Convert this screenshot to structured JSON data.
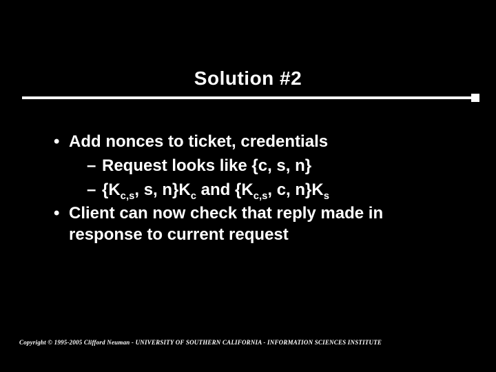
{
  "title": "Solution #2",
  "bullets": {
    "b1": "Add nonces to ticket, credentials",
    "b1a": "Request looks like {c, s, n}",
    "b1b_p1": "{K",
    "b1b_sub1": "c,s",
    "b1b_p2": ", s, n}K",
    "b1b_sub2": "c",
    "b1b_p3": " and {K",
    "b1b_sub3": "c,s",
    "b1b_p4": ", c, n}K",
    "b1b_sub4": "s",
    "b2": "Client can now check that reply made in response to current request"
  },
  "footer": "Copyright © 1995-2005 Clifford Neuman - UNIVERSITY OF SOUTHERN CALIFORNIA - INFORMATION SCIENCES INSTITUTE",
  "glyphs": {
    "dot": "•",
    "dash": "–"
  }
}
